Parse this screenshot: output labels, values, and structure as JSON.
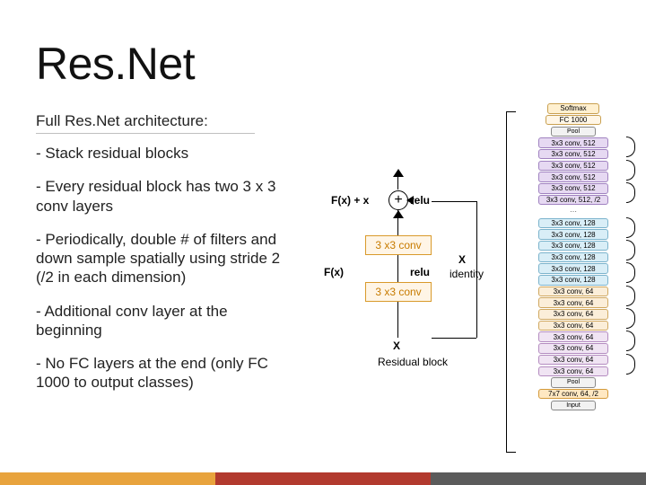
{
  "title": "Res.Net",
  "subtitle": "Full Res.Net architecture:",
  "bullets": [
    "- Stack residual blocks",
    "- Every residual block has two 3 x 3 conv layers",
    "- Periodically, double # of filters and down sample spatially using stride 2 (/2 in each dimension)",
    "- Additional conv layer at the beginning",
    "- No FC layers at the end (only FC 1000 to output classes)"
  ],
  "diagram": {
    "fx_plus_x": "F(x) + x",
    "relu": "relu",
    "fx": "F(x)",
    "conv": "3 x3 conv",
    "x": "X",
    "identity": "identity",
    "caption": "Residual block"
  },
  "arch": {
    "top": [
      "Softmax",
      "FC 1000",
      "Pool"
    ],
    "g4": [
      "3x3 conv, 512",
      "3x3 conv, 512",
      "3x3 conv, 512",
      "3x3 conv, 512",
      "3x3 conv, 512",
      "3x3 conv, 512, /2"
    ],
    "g3": [
      "3x3 conv, 128",
      "3x3 conv, 128",
      "3x3 conv, 128",
      "3x3 conv, 128",
      "3x3 conv, 128",
      "3x3 conv, 128"
    ],
    "g2": [
      "3x3 conv, 64",
      "3x3 conv, 64",
      "3x3 conv, 64",
      "3x3 conv, 64"
    ],
    "g1": [
      "3x3 conv, 64",
      "3x3 conv, 64",
      "3x3 conv, 64",
      "3x3 conv, 64"
    ],
    "pool": "Pool",
    "conv1": "7x7 conv, 64, /2",
    "input": "Input"
  }
}
